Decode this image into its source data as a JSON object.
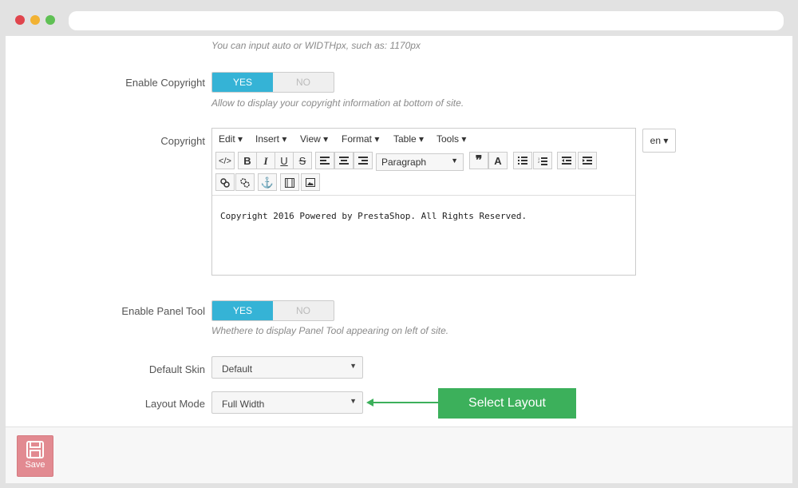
{
  "browser": {
    "dots": [
      "#e0454d",
      "#f2b233",
      "#5fc054"
    ]
  },
  "width_field": {
    "help": "You can input auto or WIDTHpx, such as: 1170px"
  },
  "enable_copyright": {
    "label": "Enable Copyright",
    "yes": "YES",
    "no": "NO",
    "help": "Allow to display your copyright information at bottom of site."
  },
  "copyright": {
    "label": "Copyright",
    "menus": [
      "Edit",
      "Insert",
      "View",
      "Format",
      "Table",
      "Tools"
    ],
    "format_select": "Paragraph",
    "content": "Copyright 2016 Powered by PrestaShop. All Rights Reserved.",
    "lang_button": "en"
  },
  "enable_panel_tool": {
    "label": "Enable Panel Tool",
    "yes": "YES",
    "no": "NO",
    "help": "Whethere to display Panel Tool appearing on left of site."
  },
  "default_skin": {
    "label": "Default Skin",
    "value": "Default"
  },
  "layout_mode": {
    "label": "Layout Mode",
    "value": "Full Width"
  },
  "annotation": {
    "text": "Select Layout",
    "color": "#3cb05b"
  },
  "footer": {
    "save_label": "Save"
  },
  "colors": {
    "accent": "#35b3d6",
    "save": "#e28a91"
  }
}
